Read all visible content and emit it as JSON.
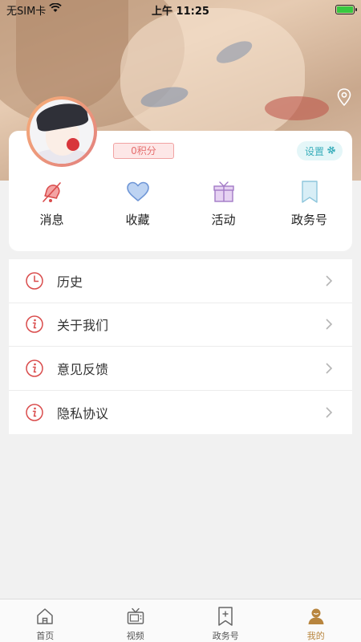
{
  "status_bar": {
    "carrier": "无SIM卡",
    "time": "上午 11:25"
  },
  "profile": {
    "points_label": "0积分",
    "settings_label": "设置"
  },
  "quick_actions": [
    {
      "label": "消息",
      "icon": "bell-muted-icon"
    },
    {
      "label": "收藏",
      "icon": "heart-icon"
    },
    {
      "label": "活动",
      "icon": "gift-icon"
    },
    {
      "label": "政务号",
      "icon": "bookmark-icon"
    }
  ],
  "menu": [
    {
      "label": "历史",
      "icon": "clock-icon"
    },
    {
      "label": "关于我们",
      "icon": "info-icon"
    },
    {
      "label": "意见反馈",
      "icon": "info-icon"
    },
    {
      "label": "隐私协议",
      "icon": "info-icon"
    }
  ],
  "tabbar": [
    {
      "label": "首页",
      "icon": "home-icon"
    },
    {
      "label": "视频",
      "icon": "tv-icon"
    },
    {
      "label": "政务号",
      "icon": "bookmark-plus-icon"
    },
    {
      "label": "我的",
      "icon": "user-icon",
      "active": true
    }
  ],
  "colors": {
    "accent_red": "#d94b4b",
    "settings_teal": "#3aaebb",
    "tab_active": "#b8853e"
  }
}
